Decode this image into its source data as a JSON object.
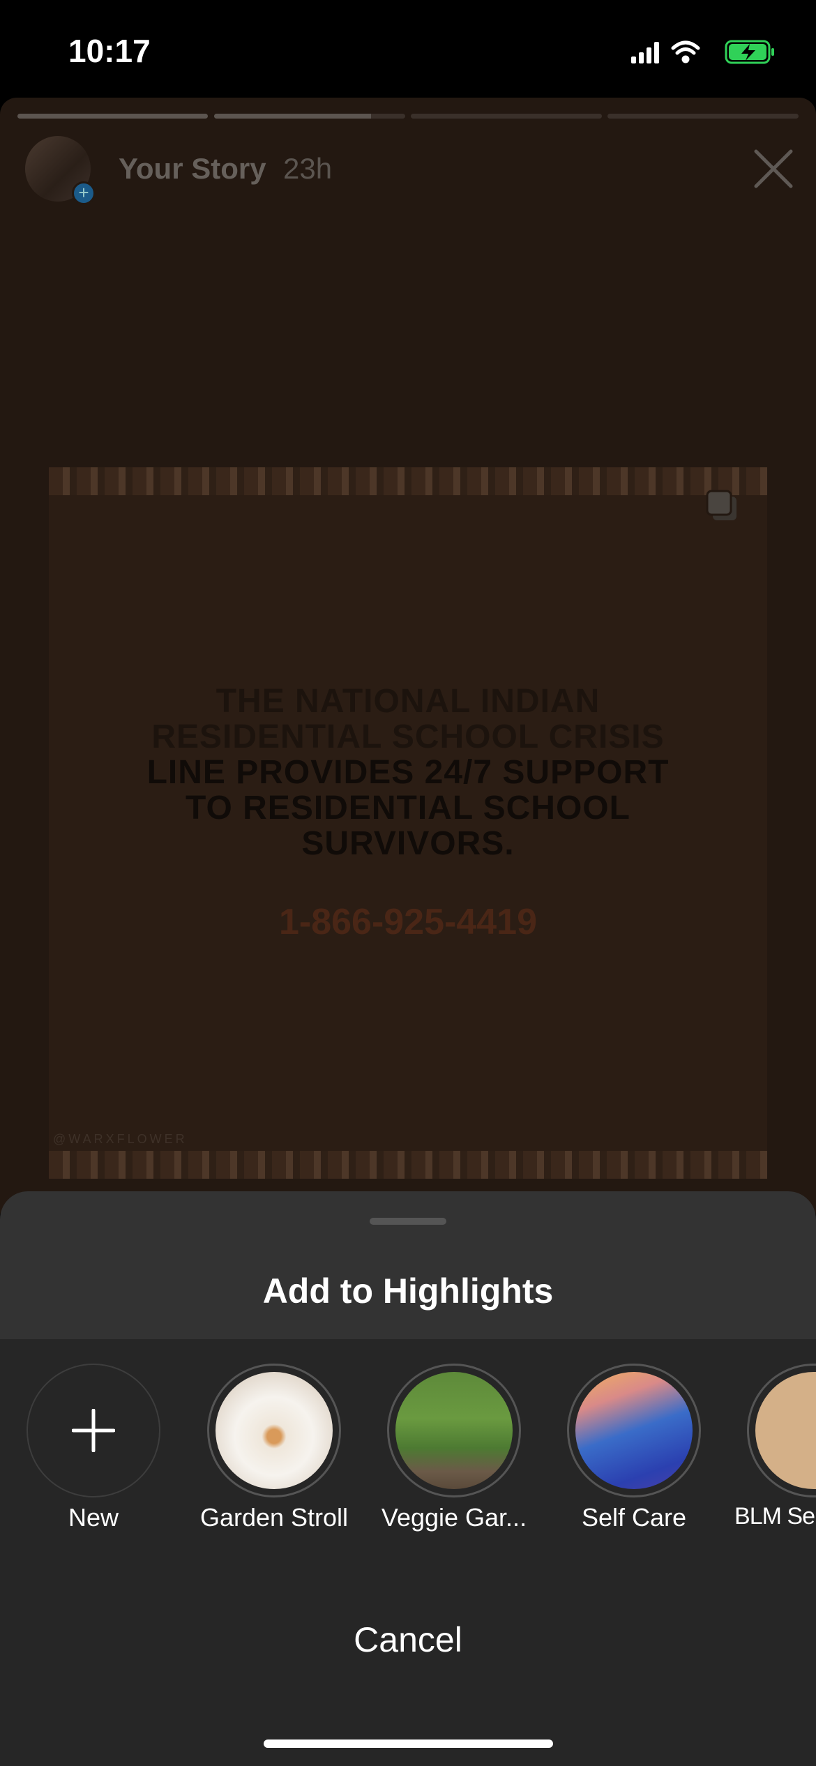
{
  "status_bar": {
    "time": "10:17",
    "icons": [
      "cellular-signal-icon",
      "wifi-icon",
      "battery-charging-icon"
    ],
    "battery_color": "#30d158"
  },
  "story": {
    "progress": [
      1,
      0.82,
      0,
      0
    ],
    "user": "Your Story",
    "age": "23h",
    "post": {
      "lines": [
        "THE NATIONAL INDIAN",
        "RESIDENTIAL SCHOOL CRISIS",
        "LINE PROVIDES 24/7 SUPPORT",
        "TO RESIDENTIAL SCHOOL",
        "SURVIVORS."
      ],
      "phone": "1-866-925-4419",
      "credit": "@WARXFLOWER"
    }
  },
  "sheet": {
    "title": "Add to Highlights",
    "highlights": [
      {
        "label": "New",
        "icon": "plus-icon"
      },
      {
        "label": "Garden Stroll"
      },
      {
        "label": "Veggie Gar..."
      },
      {
        "label": "Self Care"
      },
      {
        "label": "BLM Se"
      }
    ],
    "cancel": "Cancel"
  }
}
